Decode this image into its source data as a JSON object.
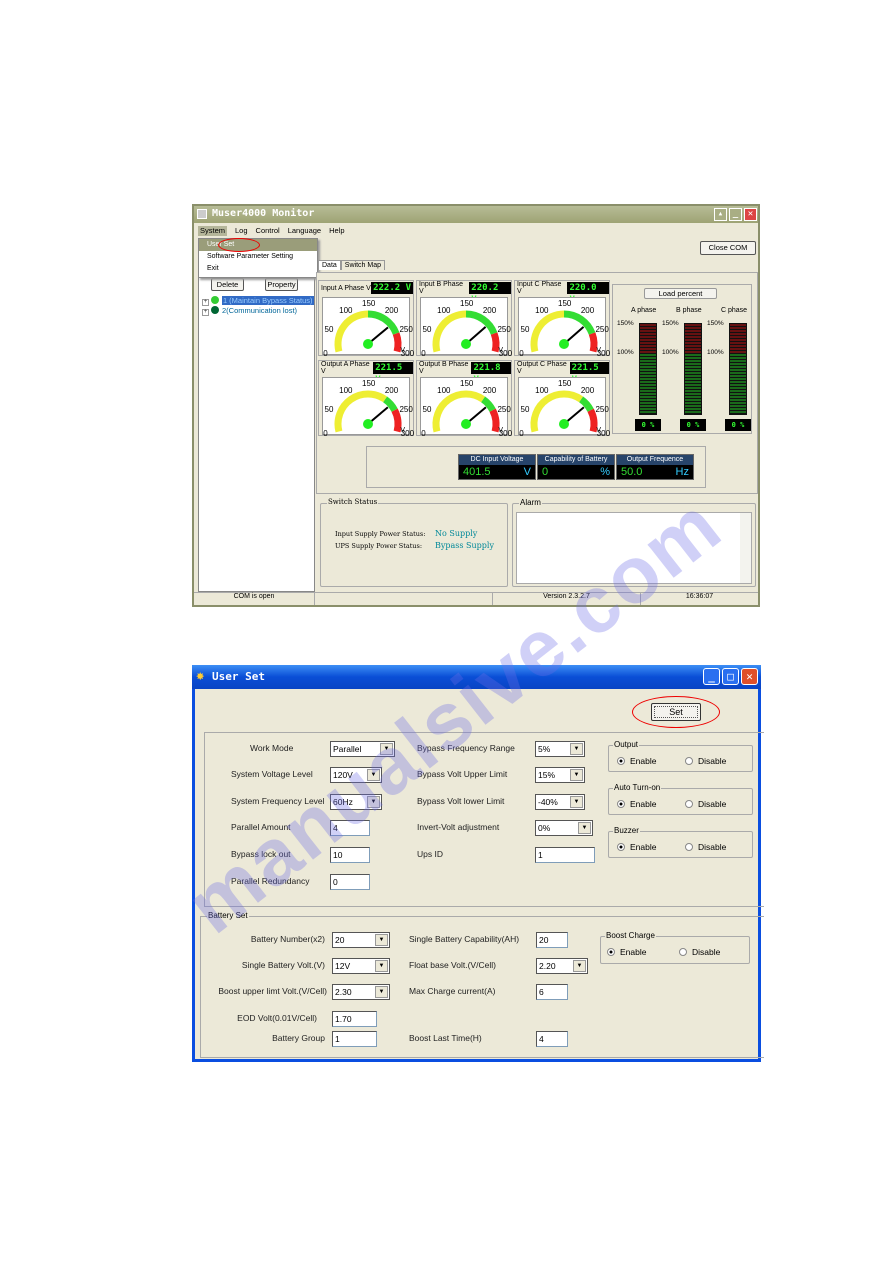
{
  "monitor": {
    "title": "Muser4000 Monitor",
    "menu": [
      "System",
      "Log",
      "Control",
      "Language",
      "Help"
    ],
    "system_menu": [
      "User Set",
      "Software Parameter Setting",
      "Exit"
    ],
    "close_com": "Close COM",
    "delete": "Delete",
    "property": "Property",
    "tree": [
      {
        "id": "1",
        "label": "(Maintain Bypass Status)",
        "color": "#3c3"
      },
      {
        "id": "2",
        "label": "(Communication lost)",
        "color": "#063"
      }
    ],
    "tabs": [
      "Data",
      "Switch Map"
    ],
    "gauges": [
      {
        "label": "Input A Phase V",
        "value": "222.2 V",
        "reading": 222.2,
        "green": [
          150,
          250
        ]
      },
      {
        "label": "Input B Phase V",
        "value": "220.2 V",
        "reading": 220.2,
        "green": [
          150,
          250
        ]
      },
      {
        "label": "Input C Phase V",
        "value": "220.0 V",
        "reading": 220.0,
        "green": [
          150,
          250
        ]
      },
      {
        "label": "Output A Phase V",
        "value": "221.5 V",
        "reading": 221.5,
        "green": [
          200,
          240
        ]
      },
      {
        "label": "Output B Phase V",
        "value": "221.8 V",
        "reading": 221.8,
        "green": [
          200,
          240
        ]
      },
      {
        "label": "Output C Phase V",
        "value": "221.5 V",
        "reading": 221.5,
        "green": [
          200,
          240
        ]
      }
    ],
    "gauge_ticks": [
      "0",
      "50",
      "100",
      "150",
      "200",
      "250",
      "300"
    ],
    "gauge_unit": "V",
    "load": {
      "title": "Load percent",
      "phases": [
        "A phase",
        "B phase",
        "C phase"
      ],
      "mark_high": "150%",
      "mark_mid": "100%",
      "values": [
        "0 %",
        "0 %",
        "0 %"
      ],
      "percent": [
        0,
        0,
        0
      ]
    },
    "readouts": [
      {
        "label": "DC Input Voltage",
        "value": "401.5",
        "unit": "V"
      },
      {
        "label": "Capability of Battery",
        "value": "0",
        "unit": "%"
      },
      {
        "label": "Output Frequence",
        "value": "50.0",
        "unit": "Hz"
      }
    ],
    "switch_status": {
      "title": "Switch Status",
      "rows": [
        {
          "label": "Input Supply Power Status:",
          "value": "No Supply"
        },
        {
          "label": "UPS Supply Power Status:",
          "value": "Bypass Supply"
        }
      ]
    },
    "alarm_title": "Alarm",
    "status": {
      "com": "COM is open",
      "version": "Version 2.3.2.7",
      "time": "16:36:07"
    }
  },
  "userset": {
    "title": "User Set",
    "set": "Set",
    "left": [
      {
        "label": "Work Mode",
        "value": "Parallel",
        "type": "select"
      },
      {
        "label": "System Voltage Level",
        "value": "120V",
        "type": "select"
      },
      {
        "label": "System Frequency Level",
        "value": "60Hz",
        "type": "select"
      },
      {
        "label": "Parallel Amount",
        "value": "4",
        "type": "input"
      },
      {
        "label": "Bypass lock out",
        "value": "10",
        "type": "input"
      },
      {
        "label": "Parallel Redundancy",
        "value": "0",
        "type": "input"
      }
    ],
    "mid": [
      {
        "label": "Bypass Frequency Range",
        "value": "5%",
        "type": "select"
      },
      {
        "label": "Bypass Volt Upper Limit",
        "value": "15%",
        "type": "select"
      },
      {
        "label": "Bypass Volt lower Limit",
        "value": "-40%",
        "type": "select"
      },
      {
        "label": "Invert-Volt adjustment",
        "value": "0%",
        "type": "select"
      },
      {
        "label": "Ups ID",
        "value": "1",
        "type": "input"
      }
    ],
    "groups": [
      {
        "title": "Output",
        "selected": "Enable"
      },
      {
        "title": "Auto Turn-on",
        "selected": "Enable"
      },
      {
        "title": "Buzzer",
        "selected": "Enable"
      }
    ],
    "enable": "Enable",
    "disable": "Disable",
    "battery": {
      "title": "Battery Set",
      "left": [
        {
          "label": "Battery Number(x2)",
          "value": "20",
          "type": "select"
        },
        {
          "label": "Single Battery Volt.(V)",
          "value": "12V",
          "type": "select"
        },
        {
          "label": "Boost upper limt Volt.(V/Cell)",
          "value": "2.30",
          "type": "select"
        },
        {
          "label": "EOD Volt(0.01V/Cell)",
          "value": "1.70",
          "type": "input"
        },
        {
          "label": "Battery Group",
          "value": "1",
          "type": "input"
        }
      ],
      "mid": [
        {
          "label": "Single Battery Capability(AH)",
          "value": "20",
          "type": "input"
        },
        {
          "label": "Float base Volt.(V/Cell)",
          "value": "2.20",
          "type": "select"
        },
        {
          "label": "Max Charge current(A)",
          "value": "6",
          "type": "input"
        },
        {
          "label": "Boost Last Time(H)",
          "value": "4",
          "type": "input"
        }
      ],
      "boost": {
        "title": "Boost Charge",
        "selected": "Enable"
      }
    }
  },
  "watermark": "manualsive.com",
  "colors": {
    "highlight": "#e00000",
    "xp_blue": "#0a4ed6",
    "olive": "#9ea374"
  }
}
